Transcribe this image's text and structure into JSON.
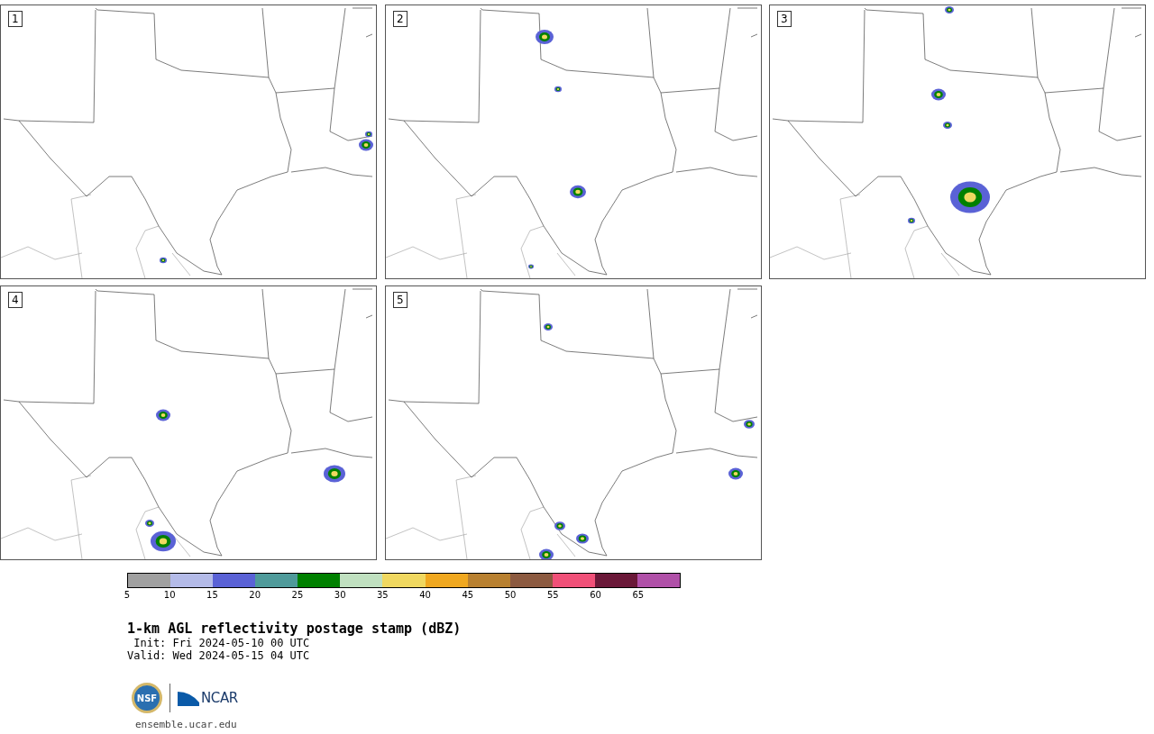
{
  "panels": [
    {
      "label": "1"
    },
    {
      "label": "2"
    },
    {
      "label": "3"
    },
    {
      "label": "4"
    },
    {
      "label": "5"
    }
  ],
  "colorbar": {
    "segments": [
      {
        "color": "#a0a0a0"
      },
      {
        "color": "#b4bbe8"
      },
      {
        "color": "#5a62d6"
      },
      {
        "color": "#4f9a9a"
      },
      {
        "color": "#008000"
      },
      {
        "color": "#c0e0c0"
      },
      {
        "color": "#f0d860"
      },
      {
        "color": "#f0a820"
      },
      {
        "color": "#b88030"
      },
      {
        "color": "#8c5a40"
      },
      {
        "color": "#f05078"
      },
      {
        "color": "#6a1838"
      },
      {
        "color": "#b050a8"
      }
    ],
    "ticks": [
      "5",
      "10",
      "15",
      "20",
      "25",
      "30",
      "35",
      "40",
      "45",
      "50",
      "55",
      "60",
      "65"
    ]
  },
  "title": "1-km AGL reflectivity postage stamp (dBZ)",
  "init": " Init: Fri 2024-05-10 00 UTC",
  "valid": "Valid: Wed 2024-05-15 04 UTC",
  "logos": {
    "nsf": "NSF",
    "ncar": "NCAR"
  },
  "url": "ensemble.ucar.edu"
}
